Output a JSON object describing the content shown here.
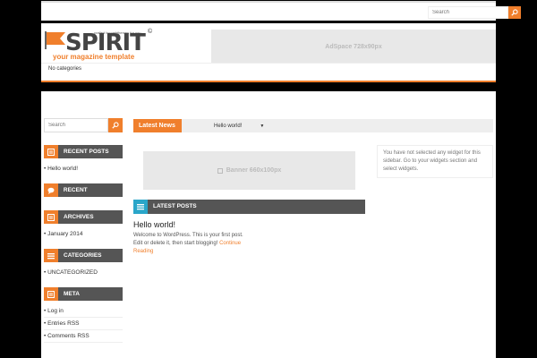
{
  "top": {
    "search_placeholder": "Search"
  },
  "header": {
    "logo_crafted": "crafted by webthemes for you",
    "logo_copy": "©",
    "logo_name": "SPIRIT",
    "logo_tagline": "your magazine template",
    "adspace": "AdSpace 728x90px",
    "nav_text": "No categories"
  },
  "sidebar": {
    "search_placeholder": "Search",
    "recent_posts": {
      "title": "Recent Posts",
      "items": [
        "Hello world!"
      ]
    },
    "recent_comments": {
      "title": "Recent Comments"
    },
    "archives": {
      "title": "Archives",
      "items": [
        "January 2014"
      ]
    },
    "categories": {
      "title": "Categories",
      "items": [
        "UNCATEGORIZED"
      ]
    },
    "meta": {
      "title": "Meta",
      "items": [
        "Log in",
        "Entries RSS",
        "Comments RSS"
      ]
    }
  },
  "ticker": {
    "label": "Latest News",
    "item": "Hello world!",
    "arrow": "▼"
  },
  "banner": "Banner 660x100px",
  "latest_posts": {
    "title": "LATEST POSTS",
    "post_title": "Hello world!",
    "excerpt": "Welcome to WordPress. This is your first post. Edit or delete it, then start blogging!",
    "more": "Continue Reading"
  },
  "right_widget": "You have not selected any widget for this sidebar. Go to your widgets section and select widgets.",
  "colors": {
    "accent": "#f07f2c",
    "dark": "#555555",
    "blue": "#2aa6c9"
  }
}
